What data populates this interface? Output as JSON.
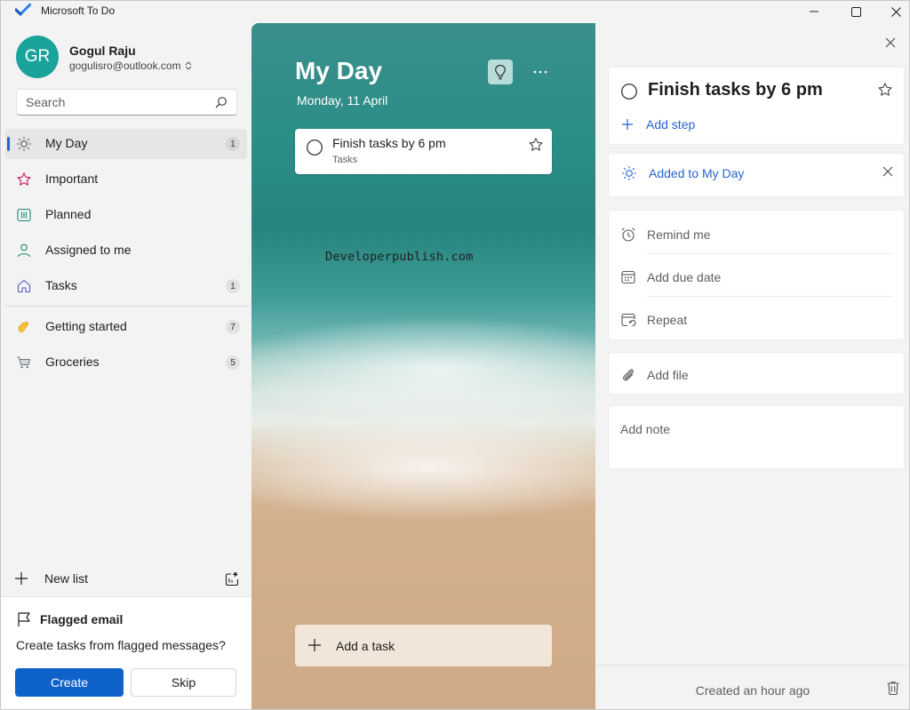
{
  "window": {
    "title": "Microsoft To Do",
    "icons": {
      "app": "todo-check-icon",
      "minimize": "minimize-icon",
      "maximize": "maximize-icon",
      "close": "close-icon"
    }
  },
  "account": {
    "initials": "GR",
    "name": "Gogul Raju",
    "email": "gogulisro@outlook.com",
    "avatar_color": "#1aa39a"
  },
  "search": {
    "placeholder": "Search",
    "icon": "search-icon"
  },
  "nav": {
    "smart_lists": [
      {
        "label": "My Day",
        "count": "1",
        "icon": "sun-icon",
        "active": true
      },
      {
        "label": "Important",
        "count": "",
        "icon": "star-icon",
        "active": false
      },
      {
        "label": "Planned",
        "count": "",
        "icon": "calendar-grid-icon",
        "active": false
      },
      {
        "label": "Assigned to me",
        "count": "",
        "icon": "person-icon",
        "active": false
      },
      {
        "label": "Tasks",
        "count": "1",
        "icon": "home-icon",
        "active": false
      }
    ],
    "lists": [
      {
        "label": "Getting started",
        "count": "7",
        "icon": "waving-hand-icon"
      },
      {
        "label": "Groceries",
        "count": "5",
        "icon": "shopping-cart-icon"
      }
    ],
    "new_list_label": "New list"
  },
  "flagged": {
    "title": "Flagged email",
    "description": "Create tasks from flagged messages?",
    "create_label": "Create",
    "skip_label": "Skip"
  },
  "main": {
    "title": "My Day",
    "date": "Monday, 11 April",
    "watermark": "Developerpublish.com",
    "task": {
      "title": "Finish tasks by 6 pm",
      "list": "Tasks"
    },
    "add_task_label": "Add a task"
  },
  "detail": {
    "task_title": "Finish tasks by 6 pm",
    "add_step_label": "Add step",
    "my_day_label": "Added to My Day",
    "remind_label": "Remind me",
    "due_label": "Add due date",
    "repeat_label": "Repeat",
    "file_label": "Add file",
    "note_placeholder": "Add note",
    "created_label": "Created an hour ago"
  },
  "colors": {
    "accent": "#2564cf",
    "primary_button": "#0f62c9",
    "sidebar_bg": "#f3f3f3",
    "important_star": "#c2185b"
  }
}
